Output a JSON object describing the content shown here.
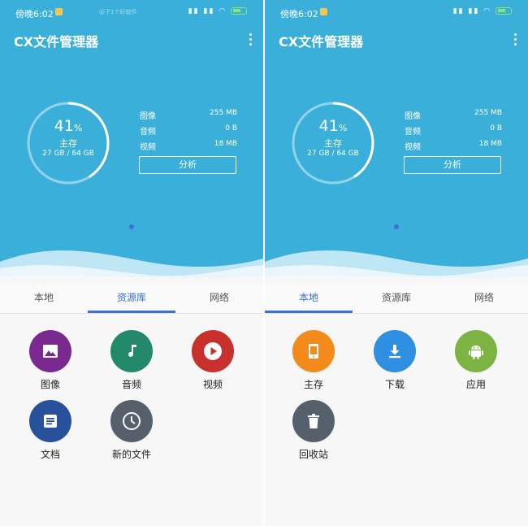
{
  "status": {
    "time": "傍晚6:02",
    "note_text": "@下1个好软件",
    "icons": "▮▮ ▮▮ ◠"
  },
  "screens": [
    {
      "app_title": "CX文件管理器",
      "storage": {
        "percent": "41",
        "percent_sign": "%",
        "name": "主存",
        "size": "27 GB / 64 GB",
        "fraction": 0.41
      },
      "stats": [
        {
          "label": "图像",
          "value": "255 MB"
        },
        {
          "label": "音频",
          "value": "0 B"
        },
        {
          "label": "视频",
          "value": "18 MB"
        }
      ],
      "analyze_label": "分析",
      "tabs": [
        "本地",
        "资源库",
        "网络"
      ],
      "active_tab": 1,
      "tiles": [
        {
          "label": "图像",
          "icon": "image-icon",
          "color": "#7a2a8f"
        },
        {
          "label": "音频",
          "icon": "music-note-icon",
          "color": "#23896a"
        },
        {
          "label": "视频",
          "icon": "play-icon",
          "color": "#c8302c"
        },
        {
          "label": "文档",
          "icon": "document-icon",
          "color": "#27519a"
        },
        {
          "label": "新的文件",
          "icon": "clock-icon",
          "color": "#56606a"
        }
      ]
    },
    {
      "app_title": "CX文件管理器",
      "storage": {
        "percent": "41",
        "percent_sign": "%",
        "name": "主存",
        "size": "27 GB / 64 GB",
        "fraction": 0.41
      },
      "stats": [
        {
          "label": "图像",
          "value": "255 MB"
        },
        {
          "label": "音频",
          "value": "0 B"
        },
        {
          "label": "视频",
          "value": "18 MB"
        }
      ],
      "analyze_label": "分析",
      "tabs": [
        "本地",
        "资源库",
        "网络"
      ],
      "active_tab": 0,
      "tiles": [
        {
          "label": "主存",
          "icon": "tablet-icon",
          "color": "#f28a1c"
        },
        {
          "label": "下载",
          "icon": "download-icon",
          "color": "#2f8fe0"
        },
        {
          "label": "应用",
          "icon": "android-icon",
          "color": "#7cb342"
        },
        {
          "label": "回收站",
          "icon": "trash-icon",
          "color": "#56606a"
        }
      ]
    }
  ]
}
